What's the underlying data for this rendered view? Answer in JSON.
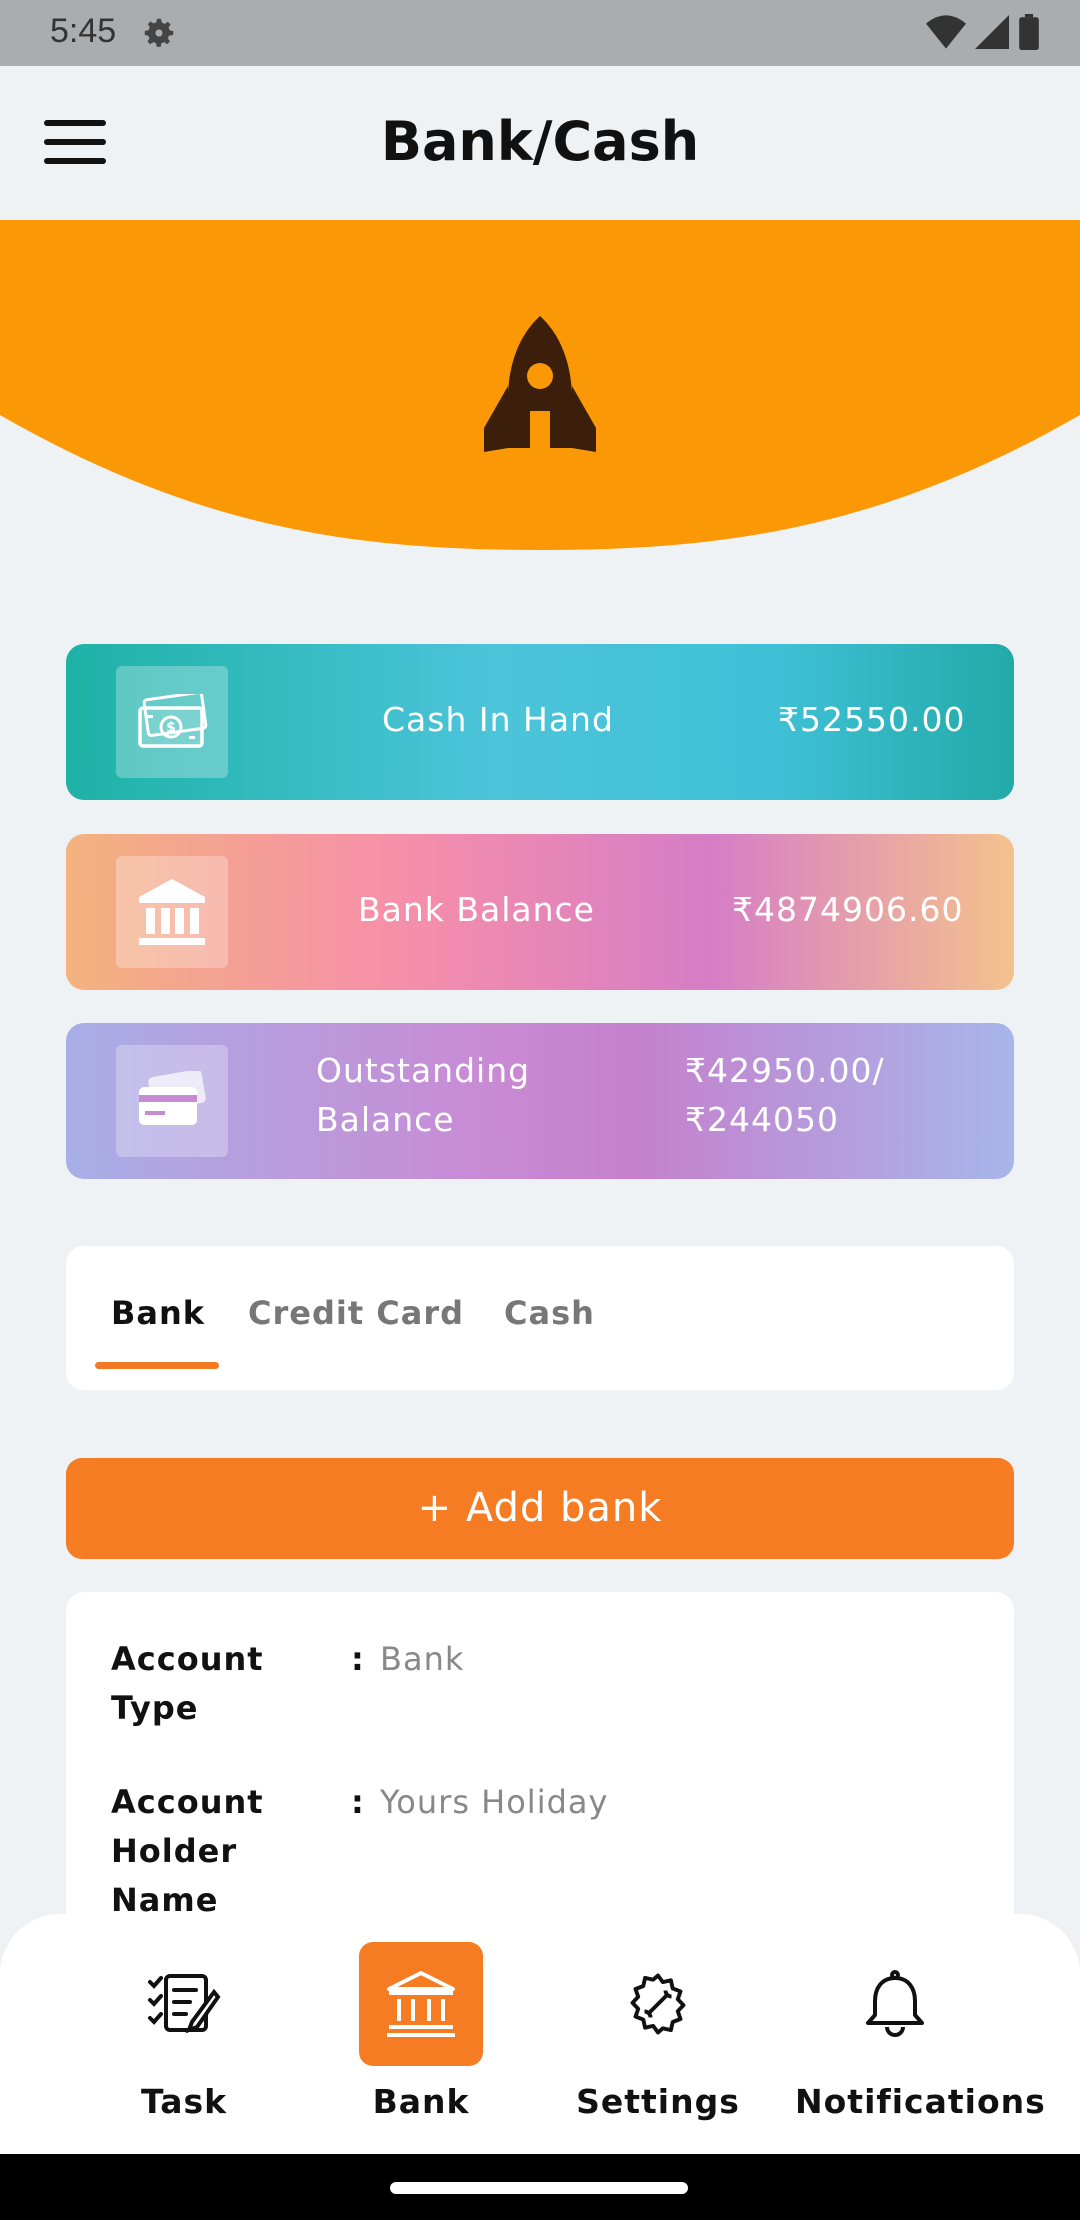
{
  "status": {
    "time": "5:45"
  },
  "header": {
    "title": "Bank/Cash"
  },
  "colors": {
    "accent": "#f67c24",
    "hero": "#fb9806",
    "rocket": "#3b1f0a"
  },
  "cards": {
    "cash": {
      "label": "Cash In Hand",
      "value": "₹52550.00",
      "icon": "cash-icon"
    },
    "bank": {
      "label": "Bank Balance",
      "value": "₹4874906.60",
      "icon": "bank-icon"
    },
    "outstanding": {
      "label_line1": "Outstanding",
      "label_line2": "Balance",
      "value_line1": "₹42950.00/",
      "value_line2": "₹244050",
      "icon": "credit-card-icon"
    }
  },
  "tabs": [
    {
      "label": "Bank",
      "active": true
    },
    {
      "label": "Credit Card",
      "active": false
    },
    {
      "label": "Cash",
      "active": false
    }
  ],
  "add_bank": {
    "label": "+ Add bank"
  },
  "account": {
    "type_label_line1": "Account",
    "type_label_line2": "Type",
    "type_value": "Bank",
    "holder_label_line1": "Account",
    "holder_label_line2": "Holder",
    "holder_label_line3": "Name",
    "holder_value": "Yours Holiday",
    "colon": ":"
  },
  "bottom_nav": [
    {
      "label": "Task",
      "icon": "task-icon",
      "active": false
    },
    {
      "label": "Bank",
      "icon": "bank-icon",
      "active": true
    },
    {
      "label": "Settings",
      "icon": "settings-icon",
      "active": false
    },
    {
      "label": "Notifications",
      "icon": "bell-icon",
      "active": false
    }
  ]
}
